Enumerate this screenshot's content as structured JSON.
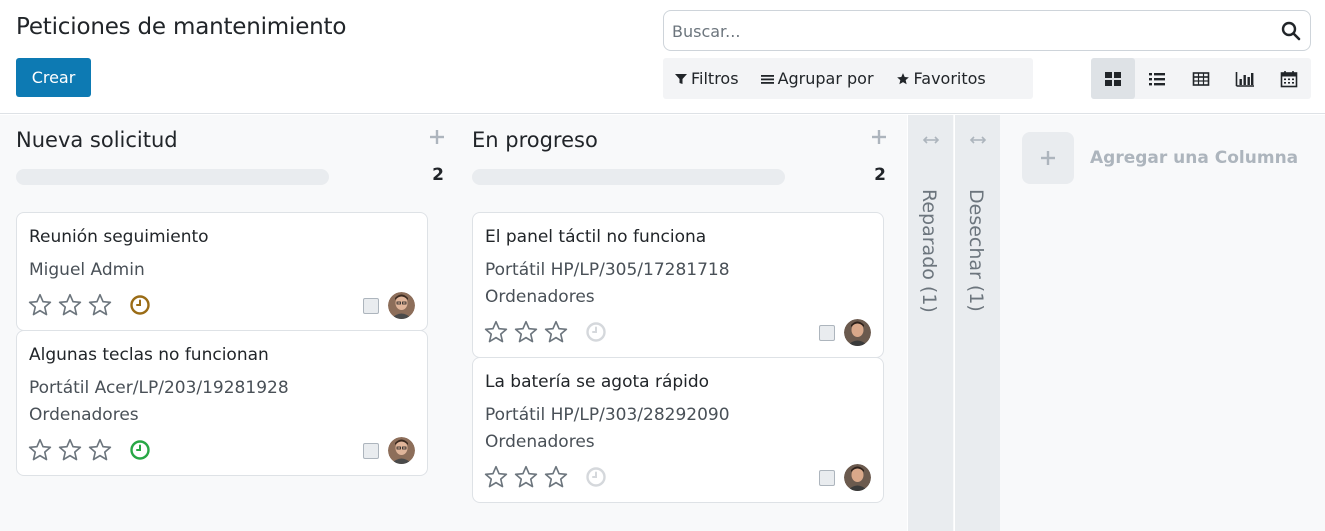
{
  "page": {
    "title": "Peticiones de mantenimiento",
    "create_label": "Crear"
  },
  "search": {
    "placeholder": "Buscar...",
    "icon": "search-icon"
  },
  "filters": {
    "filters_label": "Filtros",
    "groupby_label": "Agrupar por",
    "favorites_label": "Favoritos"
  },
  "views": [
    "kanban",
    "list",
    "pivot",
    "graph",
    "calendar"
  ],
  "active_view": "kanban",
  "columns": [
    {
      "title": "Nueva solicitud",
      "count": "2",
      "cards": [
        {
          "title": "Reunión seguimiento",
          "lines": [
            "Miguel Admin"
          ],
          "stars": 0,
          "activity_color": "#9a6c16"
        },
        {
          "title": "Algunas teclas no funcionan",
          "lines": [
            "Portátil Acer/LP/203/19281928",
            "Ordenadores"
          ],
          "stars": 0,
          "activity_color": "#28a745"
        }
      ]
    },
    {
      "title": "En progreso",
      "count": "2",
      "cards": [
        {
          "title": "El panel táctil no funciona",
          "lines": [
            "Portátil HP/LP/305/17281718",
            "Ordenadores"
          ],
          "stars": 0,
          "activity_color": "#d5d8dc"
        },
        {
          "title": "La batería se agota rápido",
          "lines": [
            "Portátil HP/LP/303/28292090",
            "Ordenadores"
          ],
          "stars": 0,
          "activity_color": "#d5d8dc"
        }
      ]
    }
  ],
  "folded_columns": [
    {
      "label": "Reparado (1)"
    },
    {
      "label": "Desechar (1)"
    }
  ],
  "add_column_label": "Agregar una Columna",
  "colors": {
    "primary": "#0d7ab3",
    "kanban_bg": "#f8f9fa",
    "folded_bg": "#e9ecef"
  }
}
